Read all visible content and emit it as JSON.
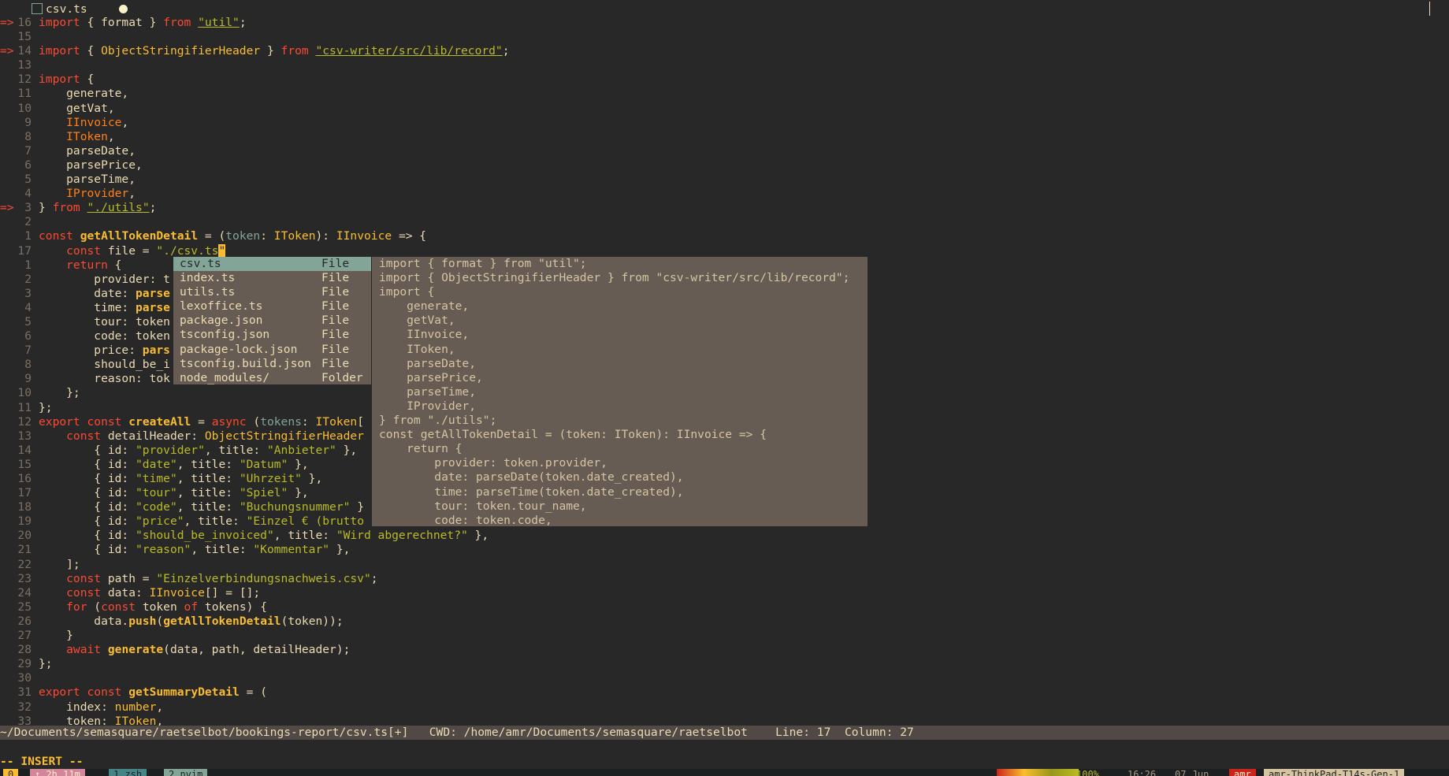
{
  "tab": {
    "filename": "csv.ts",
    "icon": "typescript-file-icon",
    "modified_indicator": "dot-icon"
  },
  "code": [
    {
      "sign": "=>",
      "num": "16",
      "segs": [
        [
          "k",
          "import"
        ],
        [
          "p",
          " { "
        ],
        [
          "p",
          "format"
        ],
        [
          "p",
          " } "
        ],
        [
          "k",
          "from"
        ],
        [
          "p",
          " "
        ],
        [
          "u",
          "\"util\""
        ],
        [
          "p",
          ";"
        ]
      ]
    },
    {
      "sign": "",
      "num": "15",
      "segs": []
    },
    {
      "sign": "=>",
      "num": "14",
      "segs": [
        [
          "k",
          "import"
        ],
        [
          "p",
          " { "
        ],
        [
          "t",
          "ObjectStringifierHeader"
        ],
        [
          "p",
          " } "
        ],
        [
          "k",
          "from"
        ],
        [
          "p",
          " "
        ],
        [
          "u",
          "\"csv-writer/src/lib/record\""
        ],
        [
          "p",
          ";"
        ]
      ]
    },
    {
      "sign": "",
      "num": "13",
      "segs": []
    },
    {
      "sign": "",
      "num": "12",
      "segs": [
        [
          "k",
          "import"
        ],
        [
          "p",
          " {"
        ]
      ]
    },
    {
      "sign": "",
      "num": "11",
      "segs": [
        [
          "p",
          "    generate,"
        ]
      ]
    },
    {
      "sign": "",
      "num": "10",
      "segs": [
        [
          "p",
          "    getVat,"
        ]
      ]
    },
    {
      "sign": "",
      "num": "9",
      "segs": [
        [
          "o",
          "    IInvoice"
        ],
        [
          "p",
          ","
        ]
      ]
    },
    {
      "sign": "",
      "num": "8",
      "segs": [
        [
          "o",
          "    IToken"
        ],
        [
          "p",
          ","
        ]
      ]
    },
    {
      "sign": "",
      "num": "7",
      "segs": [
        [
          "p",
          "    parseDate,"
        ]
      ]
    },
    {
      "sign": "",
      "num": "6",
      "segs": [
        [
          "p",
          "    parsePrice,"
        ]
      ]
    },
    {
      "sign": "",
      "num": "5",
      "segs": [
        [
          "p",
          "    parseTime,"
        ]
      ]
    },
    {
      "sign": "",
      "num": "4",
      "segs": [
        [
          "o",
          "    IProvider"
        ],
        [
          "p",
          ","
        ]
      ]
    },
    {
      "sign": "=>",
      "num": "3",
      "segs": [
        [
          "p",
          "} "
        ],
        [
          "k",
          "from"
        ],
        [
          "p",
          " "
        ],
        [
          "u",
          "\"./utils\""
        ],
        [
          "p",
          ";"
        ]
      ]
    },
    {
      "sign": "",
      "num": "2",
      "segs": []
    },
    {
      "sign": "",
      "num": "1",
      "segs": [
        [
          "k",
          "const"
        ],
        [
          "p",
          " "
        ],
        [
          "f",
          "getAllTokenDetail"
        ],
        [
          "p",
          " = ("
        ],
        [
          "a",
          "token"
        ],
        [
          "p",
          ": "
        ],
        [
          "t",
          "IToken"
        ],
        [
          "p",
          "): "
        ],
        [
          "t",
          "IInvoice"
        ],
        [
          "p",
          " => {"
        ]
      ]
    },
    {
      "sign": "",
      "num": "17",
      "cursor": true,
      "segs": [
        [
          "k",
          "    const"
        ],
        [
          "p",
          " file = "
        ],
        [
          "s",
          "\"./csv.ts"
        ]
      ]
    },
    {
      "sign": "",
      "num": "1",
      "segs": [
        [
          "k",
          "    return"
        ],
        [
          "p",
          " {"
        ]
      ]
    },
    {
      "sign": "",
      "num": "2",
      "segs": [
        [
          "p",
          "        provider: t"
        ]
      ]
    },
    {
      "sign": "",
      "num": "3",
      "segs": [
        [
          "p",
          "        date: "
        ],
        [
          "f",
          "parse"
        ]
      ]
    },
    {
      "sign": "",
      "num": "4",
      "segs": [
        [
          "p",
          "        time: "
        ],
        [
          "f",
          "parse"
        ]
      ]
    },
    {
      "sign": "",
      "num": "5",
      "segs": [
        [
          "p",
          "        tour: token"
        ]
      ]
    },
    {
      "sign": "",
      "num": "6",
      "segs": [
        [
          "p",
          "        code: token"
        ]
      ]
    },
    {
      "sign": "",
      "num": "7",
      "segs": [
        [
          "p",
          "        price: "
        ],
        [
          "f",
          "pars"
        ]
      ]
    },
    {
      "sign": "",
      "num": "8",
      "segs": [
        [
          "p",
          "        should_be_i"
        ]
      ]
    },
    {
      "sign": "",
      "num": "9",
      "segs": [
        [
          "p",
          "        reason: tok"
        ]
      ]
    },
    {
      "sign": "",
      "num": "10",
      "segs": [
        [
          "p",
          "    };"
        ]
      ]
    },
    {
      "sign": "",
      "num": "11",
      "segs": [
        [
          "p",
          "};"
        ]
      ]
    },
    {
      "sign": "",
      "num": "12",
      "segs": [
        [
          "k",
          "export"
        ],
        [
          "p",
          " "
        ],
        [
          "k",
          "const"
        ],
        [
          "p",
          " "
        ],
        [
          "f",
          "createAll"
        ],
        [
          "p",
          " = "
        ],
        [
          "k",
          "async"
        ],
        [
          "p",
          " ("
        ],
        [
          "a",
          "tokens"
        ],
        [
          "p",
          ": "
        ],
        [
          "t",
          "IToken"
        ],
        [
          "p",
          "["
        ]
      ]
    },
    {
      "sign": "",
      "num": "13",
      "segs": [
        [
          "k",
          "    const"
        ],
        [
          "p",
          " detailHeader: "
        ],
        [
          "t",
          "ObjectStringifierHeader"
        ]
      ]
    },
    {
      "sign": "",
      "num": "14",
      "segs": [
        [
          "p",
          "        { id: "
        ],
        [
          "s",
          "\"provider\""
        ],
        [
          "p",
          ", title: "
        ],
        [
          "s",
          "\"Anbieter\""
        ],
        [
          "p",
          " },"
        ]
      ]
    },
    {
      "sign": "",
      "num": "15",
      "segs": [
        [
          "p",
          "        { id: "
        ],
        [
          "s",
          "\"date\""
        ],
        [
          "p",
          ", title: "
        ],
        [
          "s",
          "\"Datum\""
        ],
        [
          "p",
          " },"
        ]
      ]
    },
    {
      "sign": "",
      "num": "16",
      "segs": [
        [
          "p",
          "        { id: "
        ],
        [
          "s",
          "\"time\""
        ],
        [
          "p",
          ", title: "
        ],
        [
          "s",
          "\"Uhrzeit\""
        ],
        [
          "p",
          " },"
        ]
      ]
    },
    {
      "sign": "",
      "num": "17",
      "segs": [
        [
          "p",
          "        { id: "
        ],
        [
          "s",
          "\"tour\""
        ],
        [
          "p",
          ", title: "
        ],
        [
          "s",
          "\"Spiel\""
        ],
        [
          "p",
          " },"
        ]
      ]
    },
    {
      "sign": "",
      "num": "18",
      "segs": [
        [
          "p",
          "        { id: "
        ],
        [
          "s",
          "\"code\""
        ],
        [
          "p",
          ", title: "
        ],
        [
          "s",
          "\"Buchungsnummer\""
        ],
        [
          "p",
          " }"
        ]
      ]
    },
    {
      "sign": "",
      "num": "19",
      "segs": [
        [
          "p",
          "        { id: "
        ],
        [
          "s",
          "\"price\""
        ],
        [
          "p",
          ", title: "
        ],
        [
          "s",
          "\"Einzel € (brutto"
        ]
      ]
    },
    {
      "sign": "",
      "num": "20",
      "segs": [
        [
          "p",
          "        { id: "
        ],
        [
          "s",
          "\"should_be_invoiced\""
        ],
        [
          "p",
          ", title: "
        ],
        [
          "s",
          "\"Wird abgerechnet?\""
        ],
        [
          "p",
          " },"
        ]
      ]
    },
    {
      "sign": "",
      "num": "21",
      "segs": [
        [
          "p",
          "        { id: "
        ],
        [
          "s",
          "\"reason\""
        ],
        [
          "p",
          ", title: "
        ],
        [
          "s",
          "\"Kommentar\""
        ],
        [
          "p",
          " },"
        ]
      ]
    },
    {
      "sign": "",
      "num": "22",
      "segs": [
        [
          "p",
          "    ];"
        ]
      ]
    },
    {
      "sign": "",
      "num": "23",
      "segs": [
        [
          "k",
          "    const"
        ],
        [
          "p",
          " path = "
        ],
        [
          "s",
          "\"Einzelverbindungsnachweis.csv\""
        ],
        [
          "p",
          ";"
        ]
      ]
    },
    {
      "sign": "",
      "num": "24",
      "segs": [
        [
          "k",
          "    const"
        ],
        [
          "p",
          " data: "
        ],
        [
          "t",
          "IInvoice"
        ],
        [
          "p",
          "[] = [];"
        ]
      ]
    },
    {
      "sign": "",
      "num": "25",
      "segs": [
        [
          "k",
          "    for"
        ],
        [
          "p",
          " ("
        ],
        [
          "k",
          "const"
        ],
        [
          "p",
          " token "
        ],
        [
          "k",
          "of"
        ],
        [
          "p",
          " tokens) {"
        ]
      ]
    },
    {
      "sign": "",
      "num": "26",
      "segs": [
        [
          "p",
          "        data."
        ],
        [
          "f",
          "push"
        ],
        [
          "p",
          "("
        ],
        [
          "f",
          "getAllTokenDetail"
        ],
        [
          "p",
          "(token));"
        ]
      ]
    },
    {
      "sign": "",
      "num": "27",
      "segs": [
        [
          "p",
          "    }"
        ]
      ]
    },
    {
      "sign": "",
      "num": "28",
      "segs": [
        [
          "k",
          "    await"
        ],
        [
          "p",
          " "
        ],
        [
          "f",
          "generate"
        ],
        [
          "p",
          "(data, path, detailHeader);"
        ]
      ]
    },
    {
      "sign": "",
      "num": "29",
      "segs": [
        [
          "p",
          "};"
        ]
      ]
    },
    {
      "sign": "",
      "num": "30",
      "segs": []
    },
    {
      "sign": "",
      "num": "31",
      "segs": [
        [
          "k",
          "export"
        ],
        [
          "p",
          " "
        ],
        [
          "k",
          "const"
        ],
        [
          "p",
          " "
        ],
        [
          "f",
          "getSummaryDetail"
        ],
        [
          "p",
          " = ("
        ]
      ]
    },
    {
      "sign": "",
      "num": "32",
      "segs": [
        [
          "p",
          "    index: "
        ],
        [
          "t",
          "number"
        ],
        [
          "p",
          ","
        ]
      ]
    },
    {
      "sign": "",
      "num": "33",
      "segs": [
        [
          "p",
          "    token: "
        ],
        [
          "t",
          "IToken"
        ],
        [
          "p",
          ","
        ]
      ]
    }
  ],
  "popup": [
    {
      "word": "csv.ts",
      "kind": "File",
      "selected": true
    },
    {
      "word": "index.ts",
      "kind": "File"
    },
    {
      "word": "utils.ts",
      "kind": "File"
    },
    {
      "word": "lexoffice.ts",
      "kind": "File"
    },
    {
      "word": "package.json",
      "kind": "File"
    },
    {
      "word": "tsconfig.json",
      "kind": "File"
    },
    {
      "word": "package-lock.json",
      "kind": "File"
    },
    {
      "word": "tsconfig.build.json",
      "kind": "File"
    },
    {
      "word": "node_modules/",
      "kind": "Folder"
    }
  ],
  "preview": [
    "import { format } from \"util\";",
    "import { ObjectStringifierHeader } from \"csv-writer/src/lib/record\";",
    "import {",
    "    generate,",
    "    getVat,",
    "    IInvoice,",
    "    IToken,",
    "    parseDate,",
    "    parsePrice,",
    "    parseTime,",
    "    IProvider,",
    "} from \"./utils\";",
    "const getAllTokenDetail = (token: IToken): IInvoice => {",
    "    return {",
    "        provider: token.provider,",
    "        date: parseDate(token.date_created),",
    "        time: parseTime(token.date_created),",
    "        tour: token.tour_name,",
    "        code: token.code,"
  ],
  "status": {
    "path": "~/Documents/semasquare/raetselbot/bookings-report/csv.ts[+]",
    "cwd": "CWD: /home/amr/Documents/semasquare/raetselbot",
    "line": "Line: 17",
    "column": "Column: 27"
  },
  "mode": "-- INSERT --",
  "tmux": {
    "session": "0",
    "uptime": "↑ 2h 11m",
    "win1": "1 zsh",
    "win2": "2 nvim",
    "battery": "100%",
    "time": "16:26",
    "date": "07 Jun",
    "user": "amr",
    "host": "amr-ThinkPad-T14s-Gen-1"
  }
}
